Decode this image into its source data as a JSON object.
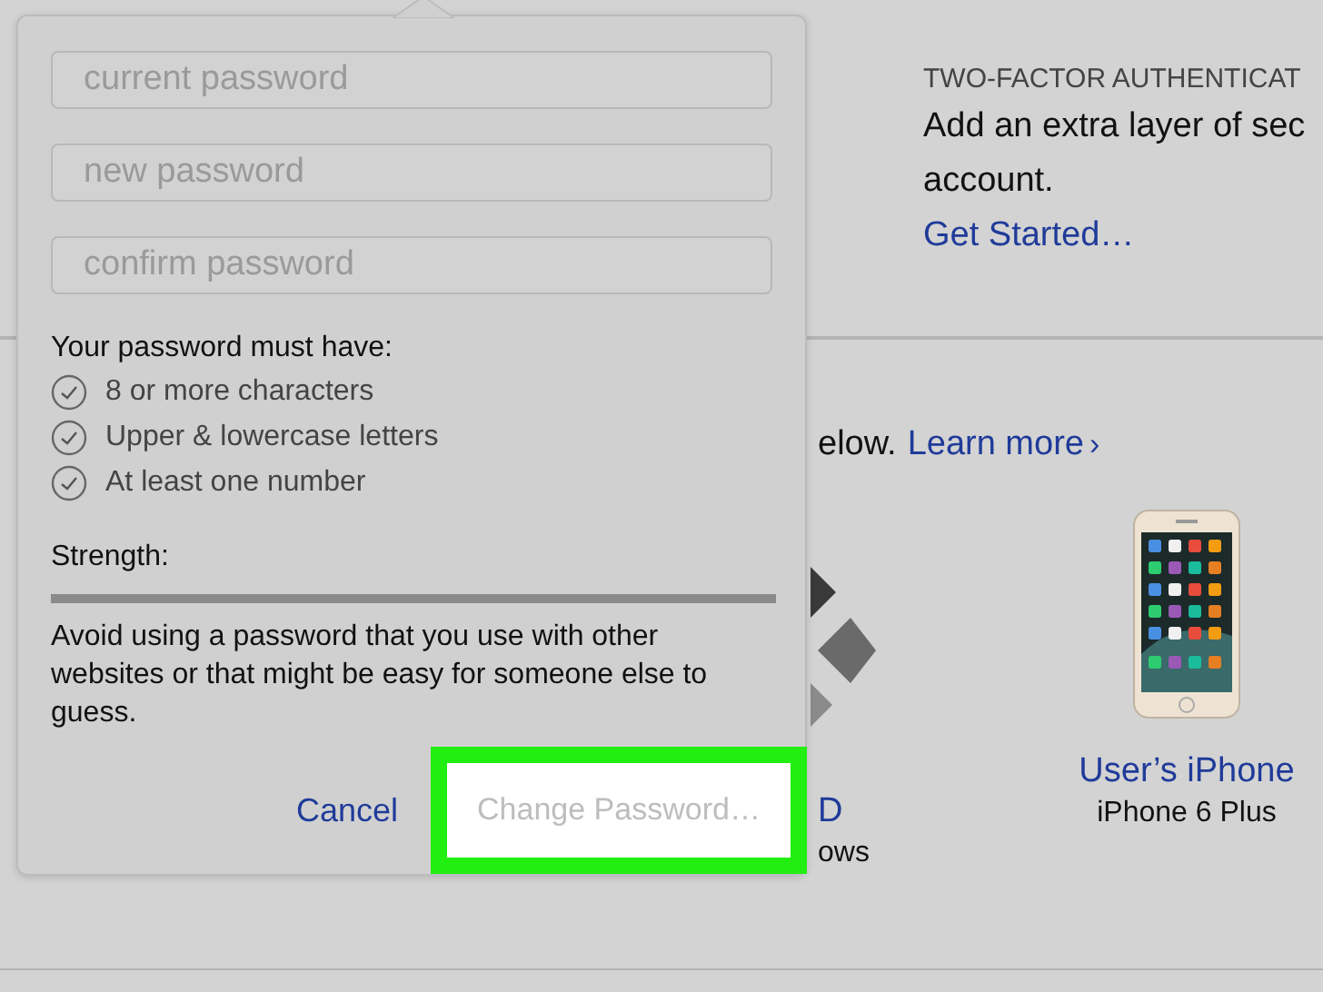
{
  "page": {
    "two_factor": {
      "heading": "TWO-FACTOR AUTHENTICAT",
      "lines": [
        "Add an extra layer of sec",
        "account."
      ],
      "link": "Get Started…"
    },
    "devices_intro": {
      "text": "elow.",
      "link": "Learn more",
      "chevron": "›"
    },
    "devices": [
      {
        "kind": "windows",
        "name": "D",
        "model": "ows"
      },
      {
        "kind": "iphone",
        "name": "User’s iPhone",
        "model": "iPhone 6 Plus"
      }
    ]
  },
  "popover": {
    "fields": [
      {
        "placeholder": "current password"
      },
      {
        "placeholder": "new password"
      },
      {
        "placeholder": "confirm password"
      }
    ],
    "rules_title": "Your password must have:",
    "rules": [
      "8 or more characters",
      "Upper & lowercase letters",
      "At least one number"
    ],
    "strength_label": "Strength:",
    "advice": "Avoid using a password that you use with other websites or that might be easy for someone else to guess.",
    "buttons": [
      {
        "kind": "link",
        "label": "Cancel",
        "disabled": false,
        "highlighted": false
      },
      {
        "kind": "primary",
        "label": "Change Password…",
        "disabled": true,
        "highlighted": true
      }
    ]
  }
}
